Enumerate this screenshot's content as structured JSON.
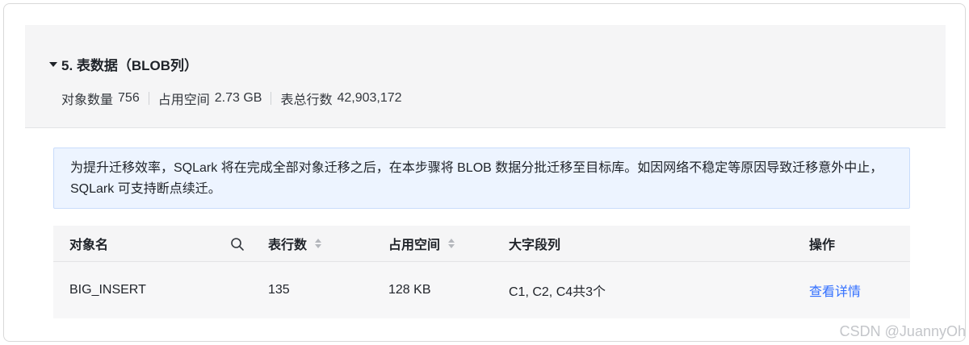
{
  "section": {
    "title": "5. 表数据（BLOB列）",
    "stats": [
      {
        "label": "对象数量",
        "value": "756"
      },
      {
        "label": "占用空间",
        "value": "2.73 GB"
      },
      {
        "label": "表总行数",
        "value": "42,903,172"
      }
    ]
  },
  "notice": {
    "text": "为提升迁移效率，SQLark 将在完成全部对象迁移之后，在本步骤将 BLOB 数据分批迁移至目标库。如因网络不稳定等原因导致迁移意外中止，SQLark 可支持断点续迁。"
  },
  "table": {
    "headers": {
      "name": "对象名",
      "rows": "表行数",
      "size": "占用空间",
      "lob_cols": "大字段列",
      "action": "操作"
    },
    "rows": [
      {
        "name": "BIG_INSERT",
        "rows": "135",
        "size": "128 KB",
        "lob_cols": "C1, C2, C4共3个",
        "action": "查看详情"
      }
    ]
  },
  "watermark": "CSDN @JuannyOh",
  "colors": {
    "link": "#3370ff",
    "notice_bg": "#edf4ff",
    "header_bg": "#f5f5f6"
  }
}
